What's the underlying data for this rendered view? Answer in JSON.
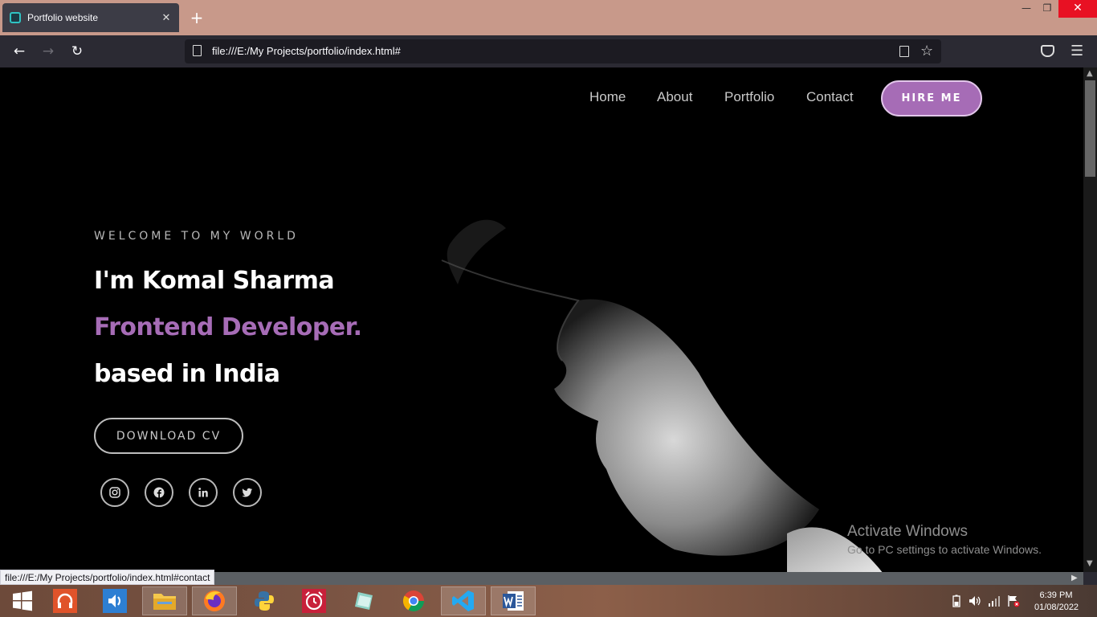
{
  "browser": {
    "tab_title": "Portfolio website",
    "tab_close": "✕",
    "new_tab": "+",
    "url": "file:///E:/My Projects/portfolio/index.html#",
    "status_url": "file:///E:/My Projects/portfolio/index.html#contact"
  },
  "site": {
    "nav": [
      "Home",
      "About",
      "Portfolio",
      "Contact"
    ],
    "hire_label": "HIRE ME",
    "welcome": "WELCOME TO MY WORLD",
    "name_line": "I'm Komal Sharma",
    "role_line": "Frontend Developer.",
    "location_line": "based in India",
    "cv_label": "DOWNLOAD CV",
    "social": [
      "instagram-icon",
      "facebook-icon",
      "linkedin-icon",
      "twitter-icon"
    ],
    "accent_color": "#a66cb6"
  },
  "watermark": {
    "title": "Activate Windows",
    "subtitle": "Go to PC settings to activate Windows."
  },
  "taskbar": {
    "apps": [
      "windows-start-icon",
      "headphones-app-icon",
      "volume-app-icon",
      "file-explorer-icon",
      "firefox-icon",
      "python-icon",
      "alarm-clock-icon",
      "notes-app-icon",
      "chrome-icon",
      "vscode-icon",
      "word-icon"
    ],
    "time": "6:39 PM",
    "date": "01/08/2022"
  }
}
